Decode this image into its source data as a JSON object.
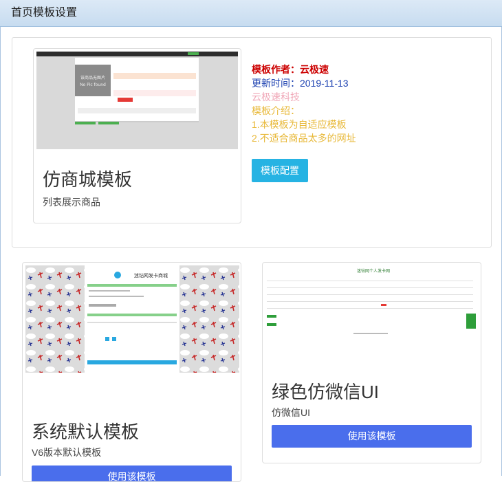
{
  "header": {
    "title": "首页模板设置"
  },
  "current": {
    "title": "仿商城模板",
    "desc": "列表展示商品",
    "author": "模板作者：云极速",
    "updated": "更新时间：2019-11-13",
    "company": "云极速科技",
    "intro_label": "模板介绍：",
    "intro_1": "1.本模板为自适应模板",
    "intro_2": "2.不适合商品太多的网址",
    "config_button": "模板配置",
    "thumb_text_1": "该商品无图片",
    "thumb_text_2": "No Pic found"
  },
  "templates": [
    {
      "title": "系统默认模板",
      "desc": "V6版本默认模板",
      "button": "使用该模板",
      "thumb_heading": "迷钻网发卡商城"
    },
    {
      "title": "绿色仿微信UI",
      "desc": "仿微信UI",
      "button": "使用该模板",
      "thumb_heading": "迷钻网个人发卡网"
    }
  ],
  "colors": {
    "author": "#cc0000",
    "updated": "#1a3fb0",
    "company": "#f0a8b8",
    "intro": "#e8b93a",
    "accent": "#4a6eec",
    "config": "#26b3e3"
  }
}
